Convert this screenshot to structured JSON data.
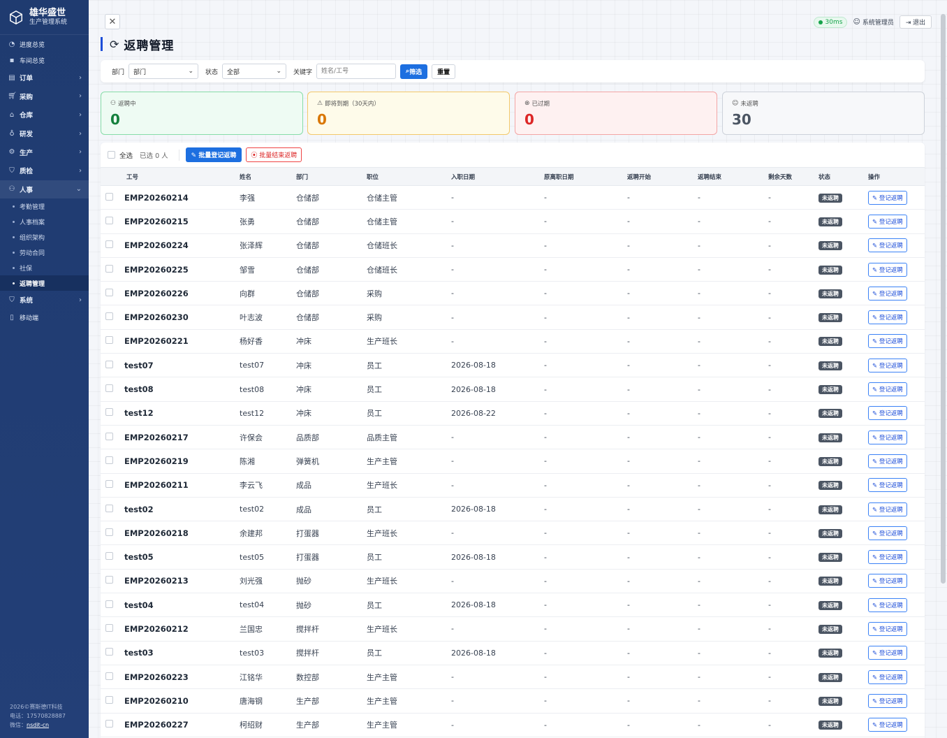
{
  "brand": {
    "title": "雄华盛世",
    "subtitle": "生产管理系统"
  },
  "nav": {
    "progress": "进度总览",
    "workshop": "车间总览",
    "order": "订单",
    "purchase": "采购",
    "warehouse": "仓库",
    "rd": "研发",
    "production": "生产",
    "quality": "质检",
    "hr": "人事",
    "hr_sub": [
      "考勤管理",
      "人事档案",
      "组织架构",
      "劳动合同",
      "社保",
      "返聘管理"
    ],
    "system": "系统",
    "mobile": "移动端"
  },
  "footer": {
    "copyright": "2026©赛斯德IT科技",
    "phone": "电话：17570828887",
    "wechat_label": "微信：",
    "wechat": "nsdit-cn"
  },
  "header": {
    "ping": "30ms",
    "user": "系统管理员",
    "logout": "退出",
    "close": "✕"
  },
  "page_title": "返聘管理",
  "filters": {
    "dept_label": "部门",
    "dept_value": "部门",
    "status_label": "状态",
    "status_value": "全部",
    "keyword_label": "关键字",
    "keyword_placeholder": "姓名/工号",
    "filter_btn": "筛选",
    "reset_btn": "重置"
  },
  "stats": {
    "rehiring": {
      "label": "返聘中",
      "value": "0"
    },
    "expiring": {
      "label": "即将到期（30天内）",
      "value": "0"
    },
    "expired": {
      "label": "已过期",
      "value": "0"
    },
    "not_rehired": {
      "label": "未返聘",
      "value": "30"
    }
  },
  "toolbar": {
    "select_all": "全选",
    "selected_prefix": "已选",
    "selected_count": "0",
    "selected_suffix": "人",
    "batch_register": "批量登记返聘",
    "batch_end": "批量结束返聘"
  },
  "columns": [
    "工号",
    "姓名",
    "部门",
    "职位",
    "入职日期",
    "原离职日期",
    "返聘开始",
    "返聘结束",
    "剩余天数",
    "状态",
    "操作"
  ],
  "row_status": "未返聘",
  "row_action": "登记返聘",
  "rows": [
    [
      "EMP20260214",
      "李强",
      "仓储部",
      "仓储主管",
      "-"
    ],
    [
      "EMP20260215",
      "张勇",
      "仓储部",
      "仓储主管",
      "-"
    ],
    [
      "EMP20260224",
      "张泽辉",
      "仓储部",
      "仓储班长",
      "-"
    ],
    [
      "EMP20260225",
      "邹雪",
      "仓储部",
      "仓储班长",
      "-"
    ],
    [
      "EMP20260226",
      "向群",
      "仓储部",
      "采购",
      "-"
    ],
    [
      "EMP20260230",
      "叶志波",
      "仓储部",
      "采购",
      "-"
    ],
    [
      "EMP20260221",
      "杨好香",
      "冲床",
      "生产班长",
      "-"
    ],
    [
      "test07",
      "test07",
      "冲床",
      "员工",
      "2026-08-18"
    ],
    [
      "test08",
      "test08",
      "冲床",
      "员工",
      "2026-08-18"
    ],
    [
      "test12",
      "test12",
      "冲床",
      "员工",
      "2026-08-22"
    ],
    [
      "EMP20260217",
      "许保会",
      "品质部",
      "品质主管",
      "-"
    ],
    [
      "EMP20260219",
      "陈湘",
      "弹簧机",
      "生产主管",
      "-"
    ],
    [
      "EMP20260211",
      "李云飞",
      "成品",
      "生产班长",
      "-"
    ],
    [
      "test02",
      "test02",
      "成品",
      "员工",
      "2026-08-18"
    ],
    [
      "EMP20260218",
      "余建邦",
      "打蛋器",
      "生产班长",
      "-"
    ],
    [
      "test05",
      "test05",
      "打蛋器",
      "员工",
      "2026-08-18"
    ],
    [
      "EMP20260213",
      "刘光强",
      "抛砂",
      "生产班长",
      "-"
    ],
    [
      "test04",
      "test04",
      "抛砂",
      "员工",
      "2026-08-18"
    ],
    [
      "EMP20260212",
      "兰国忠",
      "搅拌杆",
      "生产班长",
      "-"
    ],
    [
      "test03",
      "test03",
      "搅拌杆",
      "员工",
      "2026-08-18"
    ],
    [
      "EMP20260223",
      "江铭华",
      "数控部",
      "生产主管",
      "-"
    ],
    [
      "EMP20260210",
      "唐海钢",
      "生产部",
      "生产主管",
      "-"
    ],
    [
      "EMP20260227",
      "柯绍财",
      "生产部",
      "生产主管",
      "-"
    ]
  ],
  "empty_cell": "-"
}
